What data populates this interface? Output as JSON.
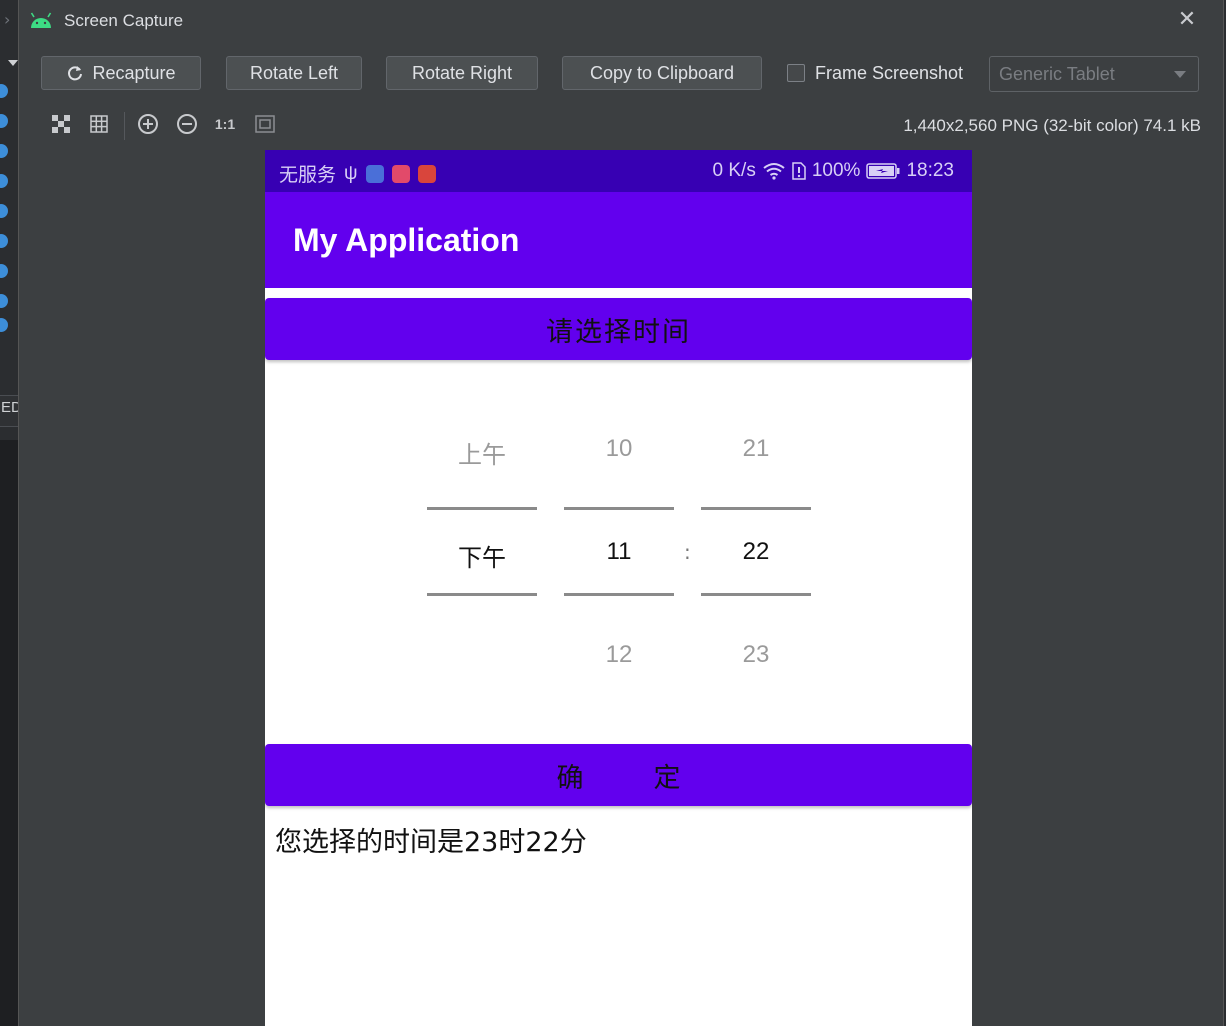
{
  "window": {
    "title": "Screen Capture",
    "close_glyph": "✕"
  },
  "ide": {
    "side_text": "ED"
  },
  "toolbar": {
    "recapture_label": "Recapture",
    "rotate_left_label": "Rotate Left",
    "rotate_right_label": "Rotate Right",
    "copy_label": "Copy to Clipboard",
    "frame_label": "Frame Screenshot",
    "frame_checked": false,
    "device_select": "Generic Tablet"
  },
  "viewer": {
    "zoom_actual_label": "1:1",
    "file_info": "1,440x2,560 PNG (32-bit color) 74.1 kB"
  },
  "phone": {
    "status": {
      "carrier": "无服务",
      "usb_glyph": "ψ",
      "net_speed": "0 K/s",
      "battery": "100%",
      "time": "18:23"
    },
    "app_title": "My Application",
    "select_time_button": "请选择时间",
    "picker": {
      "ampm": {
        "above": "上午",
        "selected": "下午",
        "below": ""
      },
      "hour": {
        "above": "10",
        "selected": "11",
        "below": "12"
      },
      "separator": ":",
      "minute": {
        "above": "21",
        "selected": "22",
        "below": "23"
      }
    },
    "confirm_button": {
      "left": "确",
      "right": "定"
    },
    "result_text": "您选择的时间是23时22分"
  },
  "colors": {
    "status_bar": "#3700b3",
    "primary": "#6200ee",
    "dialog_bg": "#3c3f41"
  }
}
